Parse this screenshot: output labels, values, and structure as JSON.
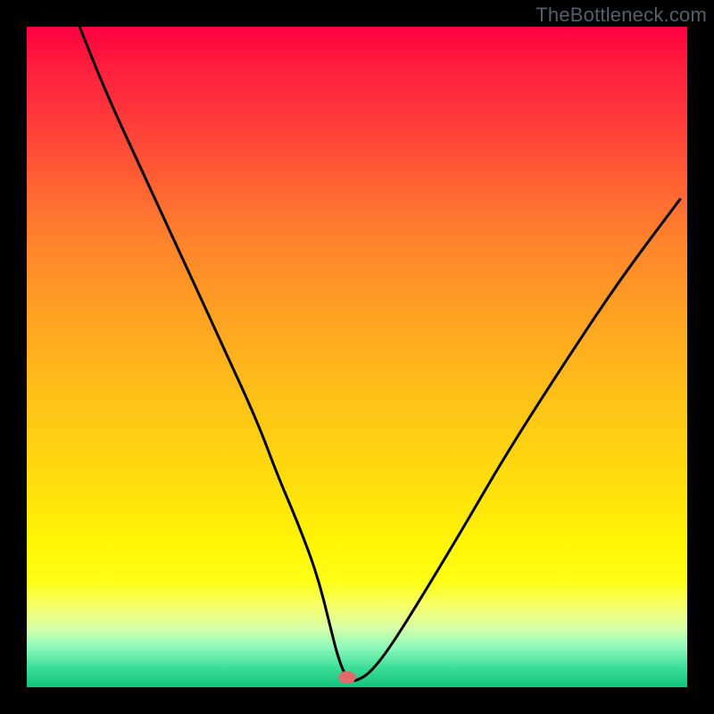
{
  "watermark": "TheBottleneck.com",
  "chart_data": {
    "type": "line",
    "title": "",
    "xlabel": "",
    "ylabel": "",
    "xlim": [
      0,
      100
    ],
    "ylim": [
      0,
      100
    ],
    "marker": {
      "x": 48.5,
      "y": 1.5
    },
    "series": [
      {
        "name": "curve",
        "x": [
          8,
          12,
          18,
          24,
          30,
          35,
          38,
          41,
          44,
          46,
          47,
          48,
          49,
          50,
          52,
          55,
          60,
          66,
          73,
          82,
          90,
          99
        ],
        "y": [
          100,
          90,
          77,
          64,
          51,
          40,
          32,
          25,
          17,
          9,
          5,
          2.2,
          1,
          1,
          2.2,
          6,
          14,
          24,
          36,
          50,
          62,
          74
        ]
      }
    ],
    "background_gradient": {
      "direction": "top-to-bottom",
      "stops": [
        {
          "pct": 0,
          "color": "#ff0040"
        },
        {
          "pct": 6,
          "color": "#ff1e3e"
        },
        {
          "pct": 14,
          "color": "#ff3a3a"
        },
        {
          "pct": 22,
          "color": "#ff5a34"
        },
        {
          "pct": 30,
          "color": "#ff7b2e"
        },
        {
          "pct": 40,
          "color": "#ff9826"
        },
        {
          "pct": 50,
          "color": "#ffb21d"
        },
        {
          "pct": 60,
          "color": "#ffca14"
        },
        {
          "pct": 70,
          "color": "#ffe00c"
        },
        {
          "pct": 78,
          "color": "#fff405"
        },
        {
          "pct": 84,
          "color": "#ffff17"
        },
        {
          "pct": 88,
          "color": "#f5ff6f"
        },
        {
          "pct": 91,
          "color": "#d8ffa8"
        },
        {
          "pct": 94,
          "color": "#8cf8bb"
        },
        {
          "pct": 97,
          "color": "#3cdf97"
        },
        {
          "pct": 100,
          "color": "#14c27b"
        }
      ]
    }
  }
}
